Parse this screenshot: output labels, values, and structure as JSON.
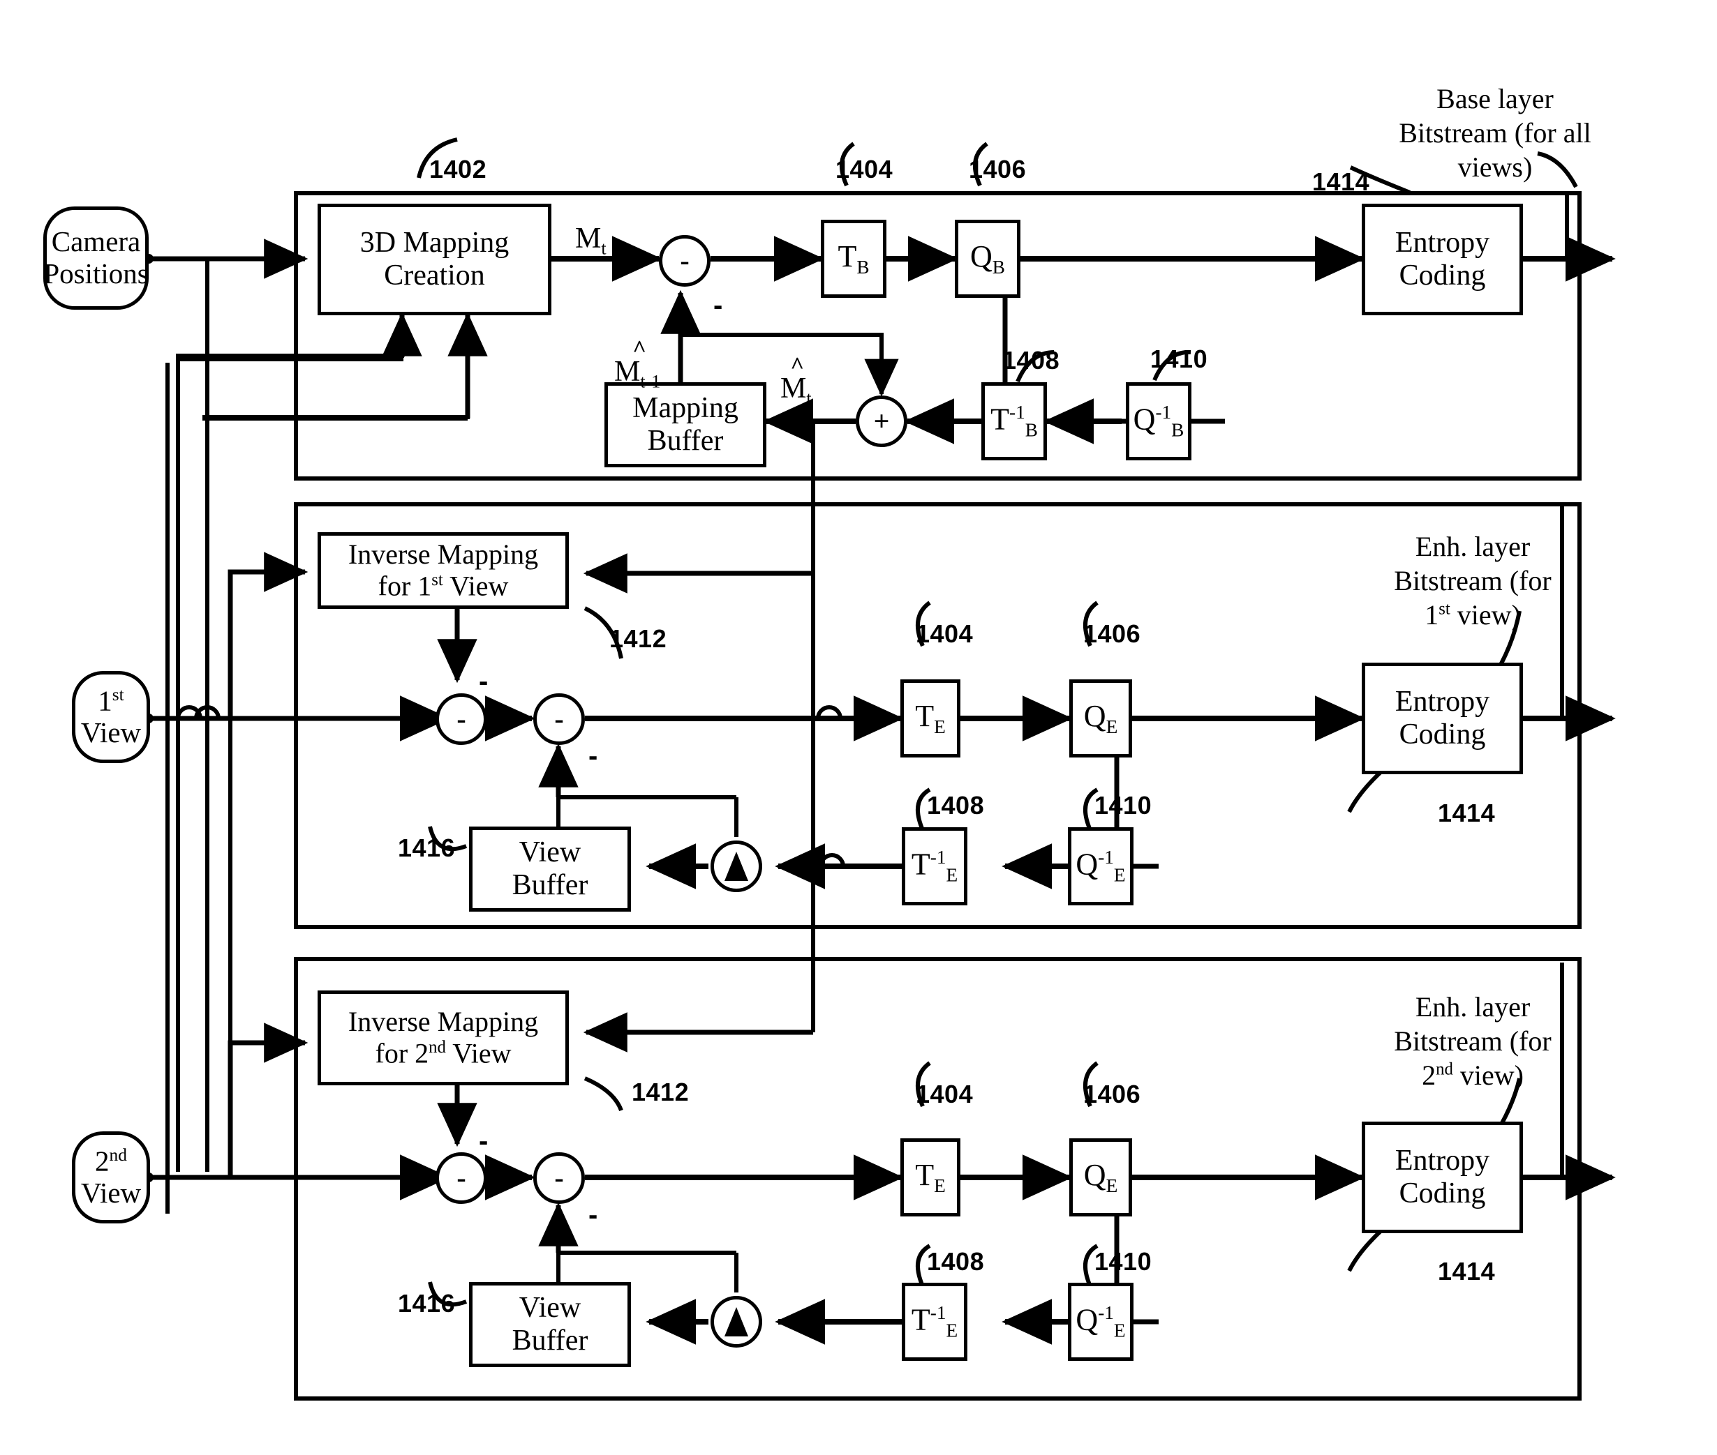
{
  "figure": {
    "type": "patent-block-diagram",
    "title": "Scalable multi-view 3D mapping encoder block diagram"
  },
  "inputs": [
    {
      "id": "camera-positions",
      "label_line1": "Camera",
      "label_line2": "Positions"
    },
    {
      "id": "first-view",
      "label_line1": "1st",
      "label_line2": "View",
      "ordinal": "1",
      "ordinal_suffix": "st"
    },
    {
      "id": "second-view",
      "label_line1": "2nd",
      "label_line2": "View",
      "ordinal": "2",
      "ordinal_suffix": "nd"
    }
  ],
  "layers": {
    "base": {
      "name": "base-layer",
      "output_caption": [
        "Base layer",
        "Bitstream (for all",
        "views)"
      ],
      "blocks": [
        {
          "id": "mapping-creation",
          "label_line1": "3D Mapping",
          "label_line2": "Creation",
          "ref": "1402"
        },
        {
          "id": "transform-base",
          "label": "T",
          "sub": "B",
          "ref": "1404"
        },
        {
          "id": "quantizer-base",
          "label": "Q",
          "sub": "B",
          "ref": "1406"
        },
        {
          "id": "entropy-base",
          "label_line1": "Entropy",
          "label_line2": "Coding",
          "ref": "1414"
        },
        {
          "id": "inv-transform-base",
          "label": "T",
          "sup": "-1",
          "sub": "B",
          "ref": "1408"
        },
        {
          "id": "inv-quantizer-base",
          "label": "Q",
          "sup": "-1",
          "sub": "B",
          "ref": "1410"
        },
        {
          "id": "mapping-buffer",
          "label_line1": "Mapping",
          "label_line2": "Buffer"
        }
      ],
      "signals": [
        {
          "id": "mt",
          "base": "M",
          "sub": "t",
          "hat": false
        },
        {
          "id": "mt-hat",
          "base": "M",
          "sub": "t",
          "hat": true
        },
        {
          "id": "mtm1-hat",
          "base": "M",
          "sub": "t-1",
          "hat": true
        }
      ],
      "operators": [
        {
          "id": "subtractor-base",
          "glyph": "-"
        },
        {
          "id": "adder-base",
          "glyph": "+"
        }
      ]
    },
    "enh_first": {
      "name": "enhancement-layer-first-view",
      "output_caption": [
        "Enh. layer",
        "Bitstream (for",
        "1st view)"
      ],
      "blocks": [
        {
          "id": "inverse-mapping-1st",
          "label_line1": "Inverse Mapping",
          "label_line2": "for 1st View",
          "ref": "1412"
        },
        {
          "id": "transform-enh-1",
          "label": "T",
          "sub": "E",
          "ref": "1404"
        },
        {
          "id": "quantizer-enh-1",
          "label": "Q",
          "sub": "E",
          "ref": "1406"
        },
        {
          "id": "entropy-enh-1",
          "label_line1": "Entropy",
          "label_line2": "Coding",
          "ref": "1414"
        },
        {
          "id": "inv-transform-enh-1",
          "label": "T",
          "sup": "-1",
          "sub": "E",
          "ref": "1408"
        },
        {
          "id": "inv-quantizer-enh-1",
          "label": "Q",
          "sup": "-1",
          "sub": "E",
          "ref": "1410"
        },
        {
          "id": "view-buffer-1",
          "label_line1": "View",
          "label_line2": "Buffer",
          "ref": "1416"
        }
      ],
      "operators": [
        {
          "id": "subtractor-enh-1-a",
          "glyph": "-"
        },
        {
          "id": "subtractor-enh-1-b",
          "glyph": "-"
        },
        {
          "id": "adder-enh-1",
          "glyph": "+"
        }
      ]
    },
    "enh_second": {
      "name": "enhancement-layer-second-view",
      "output_caption": [
        "Enh. layer",
        "Bitstream (for",
        "2nd view)"
      ],
      "blocks": [
        {
          "id": "inverse-mapping-2nd",
          "label_line1": "Inverse Mapping",
          "label_line2": "for 2nd View",
          "ref": "1412"
        },
        {
          "id": "transform-enh-2",
          "label": "T",
          "sub": "E",
          "ref": "1404"
        },
        {
          "id": "quantizer-enh-2",
          "label": "Q",
          "sub": "E",
          "ref": "1406"
        },
        {
          "id": "entropy-enh-2",
          "label_line1": "Entropy",
          "label_line2": "Coding",
          "ref": "1414"
        },
        {
          "id": "inv-transform-enh-2",
          "label": "T",
          "sup": "-1",
          "sub": "E",
          "ref": "1408"
        },
        {
          "id": "inv-quantizer-enh-2",
          "label": "Q",
          "sup": "-1",
          "sub": "E",
          "ref": "1410"
        },
        {
          "id": "view-buffer-2",
          "label_line1": "View",
          "label_line2": "Buffer",
          "ref": "1416"
        }
      ],
      "operators": [
        {
          "id": "subtractor-enh-2-a",
          "glyph": "-"
        },
        {
          "id": "subtractor-enh-2-b",
          "glyph": "-"
        },
        {
          "id": "adder-enh-2",
          "glyph": "+"
        }
      ]
    }
  },
  "text": {
    "camera_l1": "Camera",
    "camera_l2": "Positions",
    "view1_l1_num": "1",
    "view1_l1_sfx": "st",
    "view1_l2": "View",
    "view2_l1_num": "2",
    "view2_l1_sfx": "nd",
    "view2_l2": "View",
    "mapping_creation_l1": "3D Mapping",
    "mapping_creation_l2": "Creation",
    "mapping_buffer_l1": "Mapping",
    "mapping_buffer_l2": "Buffer",
    "entropy_l1": "Entropy",
    "entropy_l2": "Coding",
    "inv_map_l1": "Inverse Mapping",
    "inv_map_1_pre": "for 1",
    "inv_map_1_sfx": "st",
    "inv_map_1_post": " View",
    "inv_map_2_pre": "for 2",
    "inv_map_2_sfx": "nd",
    "inv_map_2_post": " View",
    "view_buffer_l1": "View",
    "view_buffer_l2": "Buffer",
    "T": "T",
    "Q": "Q",
    "sub_B": "B",
    "sub_E": "E",
    "inv": "-1",
    "minus": "-",
    "plus": "+",
    "base_cap_1": "Base layer",
    "base_cap_2": "Bitstream (for all",
    "base_cap_3": "views)",
    "enh1_cap_1": "Enh. layer",
    "enh1_cap_2": "Bitstream (for",
    "enh1_cap_3a": "1",
    "enh1_cap_3b": "st",
    "enh1_cap_3c": " view)",
    "enh2_cap_1": "Enh. layer",
    "enh2_cap_2": "Bitstream (for",
    "enh2_cap_3a": "2",
    "enh2_cap_3b": "nd",
    "enh2_cap_3c": " view)",
    "M": "M",
    "sub_t": "t",
    "sub_tm1": "t-1",
    "hat": "^",
    "n1402": "1402",
    "n1404": "1404",
    "n1406": "1406",
    "n1408": "1408",
    "n1410": "1410",
    "n1412": "1412",
    "n1414": "1414",
    "n1416": "1416"
  }
}
